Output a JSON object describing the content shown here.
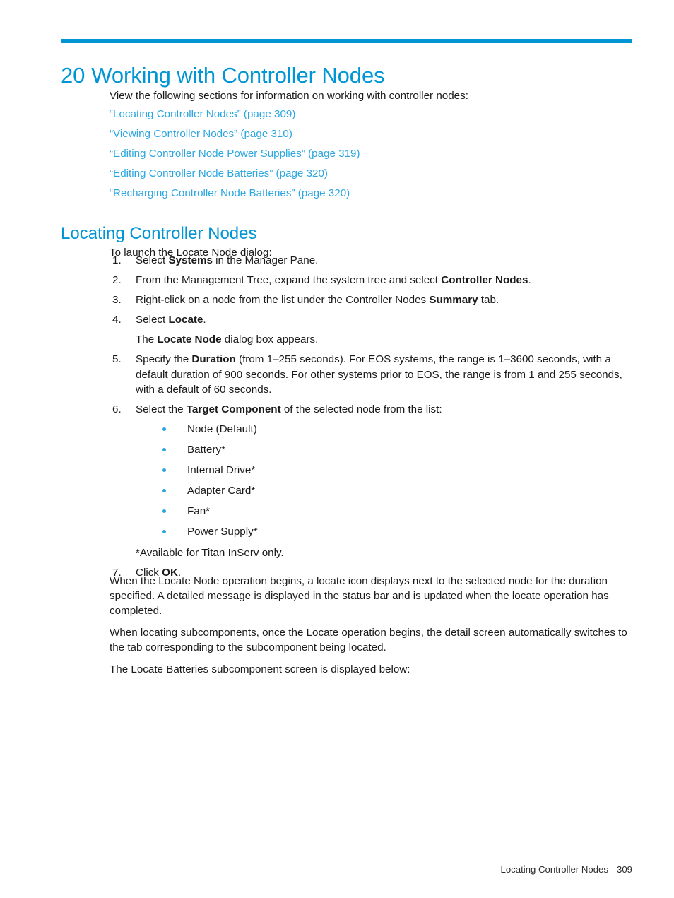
{
  "chapter": {
    "number": "20",
    "title": "Working with Controller Nodes",
    "rule_color": "#0096d6",
    "heading_color": "#0096d6"
  },
  "intro": {
    "text": "View the following sections for information on working with controller nodes:"
  },
  "cross_references": [
    {
      "label": "“Locating Controller Nodes” (page 309)"
    },
    {
      "label": "“Viewing Controller Nodes” (page 310)"
    },
    {
      "label": "“Editing Controller Node Power Supplies” (page 319)"
    },
    {
      "label": "“Editing Controller Node Batteries” (page 320)"
    },
    {
      "label": "“Recharging Controller Node Batteries” (page 320)"
    }
  ],
  "section": {
    "heading": "Locating Controller Nodes",
    "lead_in": "To launch the Locate Node dialog:",
    "steps": [
      {
        "number": "1.",
        "parts": [
          {
            "text": "Select ",
            "bold": false
          },
          {
            "text": "Systems",
            "bold": true
          },
          {
            "text": " in the Manager Pane.",
            "bold": false
          }
        ]
      },
      {
        "number": "2.",
        "parts": [
          {
            "text": "From the Management Tree, expand the system tree and select ",
            "bold": false
          },
          {
            "text": "Controller Nodes",
            "bold": true
          },
          {
            "text": ".",
            "bold": false
          }
        ]
      },
      {
        "number": "3.",
        "parts": [
          {
            "text": "Right-click on a node from the list under the Controller Nodes ",
            "bold": false
          },
          {
            "text": "Summary",
            "bold": true
          },
          {
            "text": " tab.",
            "bold": false
          }
        ]
      },
      {
        "number": "4.",
        "parts": [
          {
            "text": "Select ",
            "bold": false
          },
          {
            "text": "Locate",
            "bold": true
          },
          {
            "text": ".",
            "bold": false
          }
        ]
      },
      {
        "number": "5.",
        "parts": [
          {
            "text": "Specify the ",
            "bold": false
          },
          {
            "text": "Duration",
            "bold": true
          },
          {
            "text": " (from 1–255 seconds). For EOS systems, the range is 1–3600 seconds, with a default duration of 900 seconds. For other systems prior to EOS, the range is from 1 and 255 seconds, with a default of 60 seconds.",
            "bold": false
          }
        ]
      },
      {
        "number": "6.",
        "parts": [
          {
            "text": "Select the ",
            "bold": false
          },
          {
            "text": "Target Component",
            "bold": true
          },
          {
            "text": " of the selected node from the list:",
            "bold": false
          }
        ]
      },
      {
        "number": "7.",
        "parts": [
          {
            "text": "Click ",
            "bold": false
          },
          {
            "text": "OK",
            "bold": true
          },
          {
            "text": ".",
            "bold": false
          }
        ]
      }
    ],
    "step4_result": {
      "parts": [
        {
          "text": "The ",
          "bold": false
        },
        {
          "text": "Locate Node",
          "bold": true
        },
        {
          "text": " dialog box appears.",
          "bold": false
        }
      ]
    },
    "target_components": [
      {
        "label": "Node (Default)"
      },
      {
        "label": "Battery*"
      },
      {
        "label": "Internal Drive*"
      },
      {
        "label": "Adapter Card*"
      },
      {
        "label": "Fan*"
      },
      {
        "label": "Power Supply*"
      }
    ],
    "target_components_footnote": "*Available for Titan InServ only.",
    "bullet_color": "#2ba6e0",
    "closing_paragraphs": [
      "When the Locate Node operation begins, a locate icon displays next to the selected node for the duration specified. A detailed message is displayed in the status bar and is updated when the locate operation has completed.",
      "When locating subcomponents, once the Locate operation begins, the detail screen automatically switches to the tab corresponding to the subcomponent being located.",
      "The Locate Batteries subcomponent screen is displayed below:"
    ]
  },
  "footer": {
    "section_label": "Locating Controller Nodes",
    "page_number": "309"
  }
}
